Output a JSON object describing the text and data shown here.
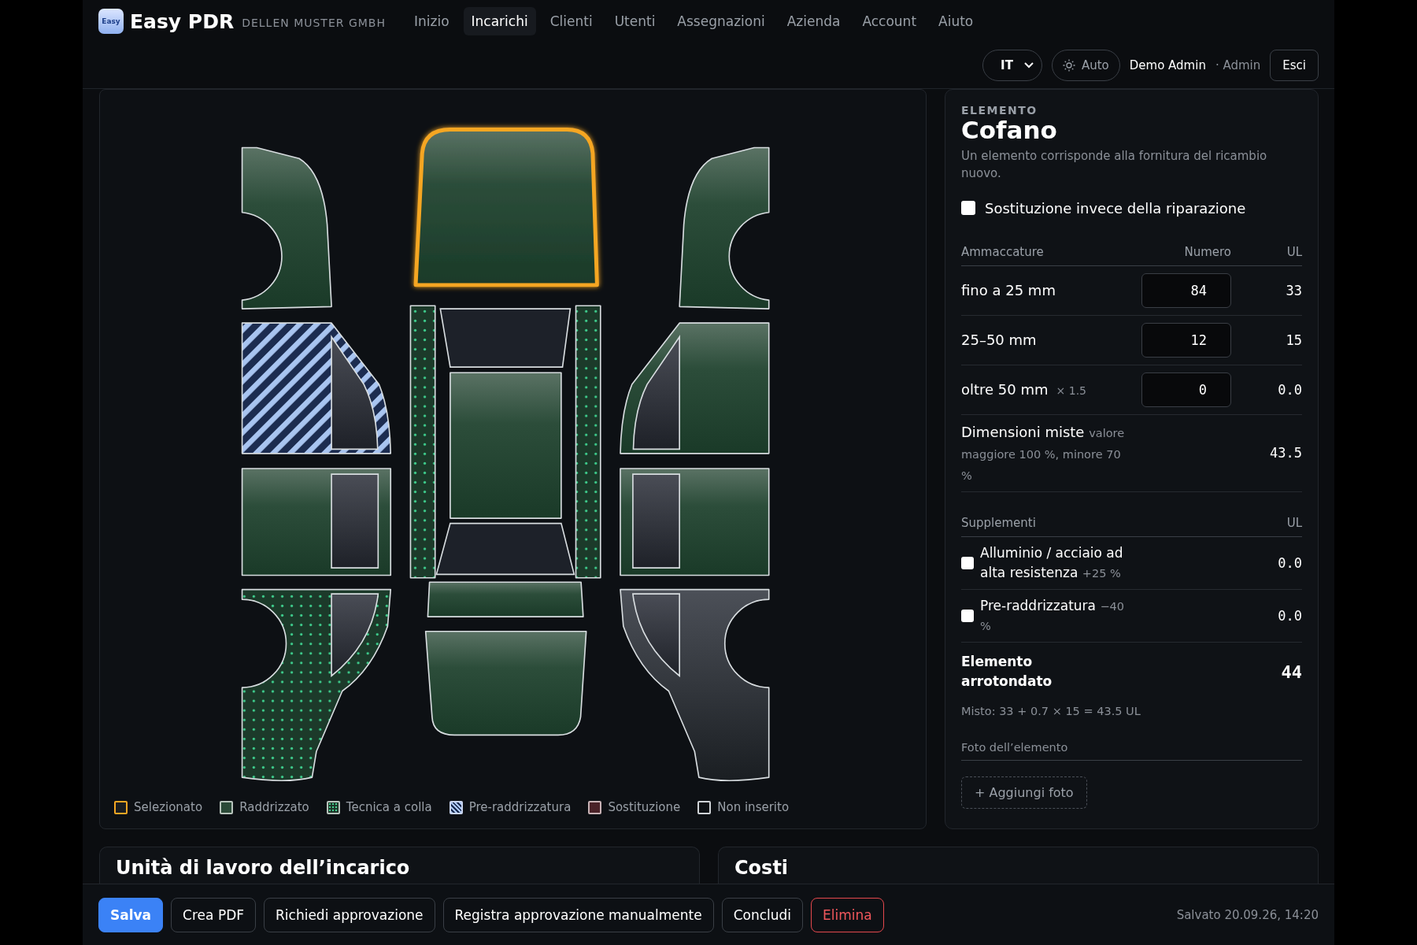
{
  "header": {
    "logo_text": "Easy",
    "brand": "Easy PDR",
    "company": "DELLEN MUSTER GMBH",
    "nav": [
      {
        "label": "Inizio",
        "selected": false
      },
      {
        "label": "Incarichi",
        "selected": true
      },
      {
        "label": "Clienti",
        "selected": false
      },
      {
        "label": "Utenti",
        "selected": false
      },
      {
        "label": "Assegnazioni",
        "selected": false
      },
      {
        "label": "Azienda",
        "selected": false
      },
      {
        "label": "Account",
        "selected": false
      },
      {
        "label": "Aiuto",
        "selected": false
      }
    ],
    "language": "IT",
    "theme": "Auto",
    "user_name": "Demo Admin",
    "separator": "·",
    "user_role": "Admin",
    "logout": "Esci"
  },
  "diagram": {
    "panels": [
      {
        "kind": "front_fender_left",
        "selected": false,
        "straightened": true,
        "glue_technique": false,
        "pre_straightened": false,
        "replaced": false
      },
      {
        "kind": "hood",
        "selected": true,
        "straightened": true,
        "glue_technique": false,
        "pre_straightened": false,
        "replaced": false
      },
      {
        "kind": "front_fender_right",
        "selected": false,
        "straightened": true,
        "glue_technique": false,
        "pre_straightened": false,
        "replaced": false
      },
      {
        "kind": "front_door_left",
        "selected": false,
        "straightened": false,
        "glue_technique": false,
        "pre_straightened": true,
        "replaced": false
      },
      {
        "kind": "sill_left",
        "selected": false,
        "straightened": false,
        "glue_technique": true,
        "pre_straightened": false,
        "replaced": false
      },
      {
        "kind": "roof",
        "selected": false,
        "straightened": true,
        "glue_technique": false,
        "pre_straightened": false,
        "replaced": false
      },
      {
        "kind": "sill_right",
        "selected": false,
        "straightened": false,
        "glue_technique": true,
        "pre_straightened": false,
        "replaced": false
      },
      {
        "kind": "front_door_right",
        "selected": false,
        "straightened": true,
        "glue_technique": false,
        "pre_straightened": false,
        "replaced": false
      },
      {
        "kind": "rear_door_left",
        "selected": false,
        "straightened": true,
        "glue_technique": false,
        "pre_straightened": false,
        "replaced": false
      },
      {
        "kind": "rear_door_right",
        "selected": false,
        "straightened": true,
        "glue_technique": false,
        "pre_straightened": false,
        "replaced": false
      },
      {
        "kind": "rear_quarter_left",
        "selected": false,
        "straightened": false,
        "glue_technique": true,
        "pre_straightened": false,
        "replaced": false
      },
      {
        "kind": "trunk",
        "selected": false,
        "straightened": true,
        "glue_technique": false,
        "pre_straightened": false,
        "replaced": false
      },
      {
        "kind": "bumper",
        "selected": false,
        "straightened": true,
        "glue_technique": false,
        "pre_straightened": false,
        "replaced": false
      },
      {
        "kind": "rear_quarter_right",
        "selected": false,
        "straightened": false,
        "glue_technique": false,
        "pre_straightened": false,
        "replaced": false
      }
    ],
    "legend": [
      {
        "kind": "selected",
        "label": "Selezionato"
      },
      {
        "kind": "repaired",
        "label": "Raddrizzato"
      },
      {
        "kind": "glue",
        "label": "Tecnica a colla"
      },
      {
        "kind": "pre",
        "label": "Pre-raddrizzatura"
      },
      {
        "kind": "replace",
        "label": "Sostituzione"
      },
      {
        "kind": "none",
        "label": "Non inserito"
      }
    ]
  },
  "element": {
    "eyebrow": "ELEMENTO",
    "title": "Cofano",
    "description": "Un elemento corrisponde alla fornitura del ricambio nuovo.",
    "replacement": {
      "label": "Sostituzione invece della riparazione",
      "checked": false
    },
    "dents_header": {
      "label": "Ammaccature",
      "count": "Numero",
      "ul": "UL"
    },
    "dents": [
      {
        "label": "fino a 25 mm",
        "value": "84",
        "ul": "33"
      },
      {
        "label": "25–50 mm",
        "value": "12",
        "ul": "15"
      },
      {
        "label": "oltre 50 mm",
        "factor": "× 1.5",
        "value": "0",
        "ul": "0.0"
      }
    ],
    "mixed": {
      "label": "Dimensioni miste",
      "note": "valore maggiore 100 %, minore 70 %",
      "ul": "43.5"
    },
    "supplements_header": {
      "label": "Supplementi",
      "ul": "UL"
    },
    "supplements": [
      {
        "label": "Alluminio / acciaio ad alta resistenza",
        "note": "+25 %",
        "checked": false,
        "ul": "0.0"
      },
      {
        "label": "Pre-raddrizzatura",
        "note": "−40 %",
        "checked": false,
        "ul": "0.0"
      }
    ],
    "total": {
      "label": "Elemento arrotondato",
      "value": "44"
    },
    "formula": "Misto: 33 + 0.7 × 15 = 43.5 UL",
    "photos": {
      "label": "Foto dell’elemento",
      "add": "+ Aggiungi foto"
    }
  },
  "sections": [
    "Unità di lavoro dell’incarico",
    "Costi"
  ],
  "actions": [
    {
      "label": "Salva",
      "kind": "primary"
    },
    {
      "label": "Crea PDF",
      "kind": "default"
    },
    {
      "label": "Richiedi approvazione",
      "kind": "default"
    },
    {
      "label": "Registra approvazione manualmente",
      "kind": "default"
    },
    {
      "label": "Concludi",
      "kind": "default"
    },
    {
      "label": "Elimina",
      "kind": "danger"
    }
  ],
  "saved": "Salvato 20.09.26, 14:20"
}
